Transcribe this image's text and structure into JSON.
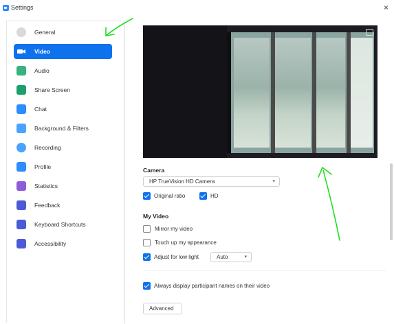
{
  "window": {
    "title": "Settings",
    "close_glyph": "×"
  },
  "sidebar": {
    "items": [
      {
        "label": "General",
        "icon": "gear-icon",
        "color": "#d9d9d9",
        "active": false
      },
      {
        "label": "Video",
        "icon": "video-camera-icon",
        "color": "#ffffff",
        "active": true
      },
      {
        "label": "Audio",
        "icon": "headphones-icon",
        "color": "#36b37e",
        "active": false
      },
      {
        "label": "Share Screen",
        "icon": "share-screen-icon",
        "color": "#1aa06b",
        "active": false
      },
      {
        "label": "Chat",
        "icon": "chat-icon",
        "color": "#2d8cff",
        "active": false
      },
      {
        "label": "Background & Filters",
        "icon": "background-icon",
        "color": "#4aa3ff",
        "active": false
      },
      {
        "label": "Recording",
        "icon": "recording-icon",
        "color": "#4aa3ff",
        "active": false
      },
      {
        "label": "Profile",
        "icon": "profile-icon",
        "color": "#2d8cff",
        "active": false
      },
      {
        "label": "Statistics",
        "icon": "statistics-icon",
        "color": "#8e5cd9",
        "active": false
      },
      {
        "label": "Feedback",
        "icon": "feedback-icon",
        "color": "#4b5bd6",
        "active": false
      },
      {
        "label": "Keyboard Shortcuts",
        "icon": "keyboard-icon",
        "color": "#4b5bd6",
        "active": false
      },
      {
        "label": "Accessibility",
        "icon": "accessibility-icon",
        "color": "#4b5bd6",
        "active": false
      }
    ]
  },
  "camera": {
    "heading": "Camera",
    "selected": "HP TrueVision HD Camera",
    "original_ratio": {
      "label": "Original ratio",
      "checked": true
    },
    "hd": {
      "label": "HD",
      "checked": true
    }
  },
  "my_video": {
    "heading": "My Video",
    "mirror": {
      "label": "Mirror my video",
      "checked": false
    },
    "touch_up": {
      "label": "Touch up my appearance",
      "checked": false
    },
    "low_light": {
      "label": "Adjust for low light",
      "checked": true,
      "mode": "Auto"
    }
  },
  "participants": {
    "label": "Always display participant names on their video",
    "checked": true
  },
  "advanced_button": "Advanced",
  "colors": {
    "accent": "#0e72ed",
    "annotation": "#22dd22"
  }
}
